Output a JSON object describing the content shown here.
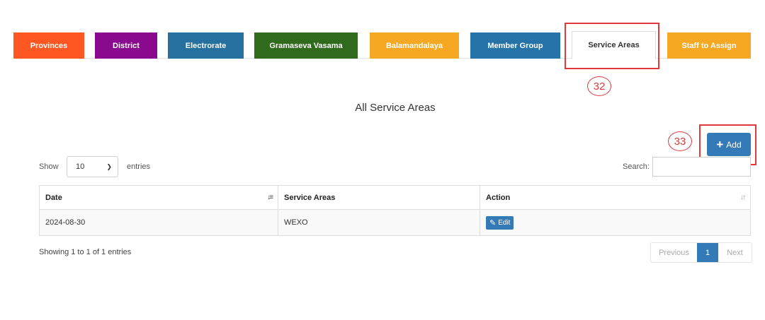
{
  "tabs": [
    {
      "label": "Provinces",
      "color": "#ff5722"
    },
    {
      "label": "District",
      "color": "#8a0a8f"
    },
    {
      "label": "Electrorate",
      "color": "#25709e"
    },
    {
      "label": "Gramaseva Vasama",
      "color": "#2f6a1d"
    },
    {
      "label": "Balamandalaya",
      "color": "#f7a823"
    },
    {
      "label": "Member Group",
      "color": "#2573a9"
    },
    {
      "label": "Service Areas",
      "active": true
    },
    {
      "label": "Staff to Assign",
      "color": "#f7a823"
    }
  ],
  "annotations": {
    "tab_marker": "32",
    "add_marker": "33",
    "color": "#e03a3a"
  },
  "page": {
    "title": "All Service Areas"
  },
  "toolbar": {
    "add_label": "Add"
  },
  "length": {
    "show_label": "Show",
    "value": "10",
    "entries_label": "entries"
  },
  "search": {
    "label": "Search:",
    "value": ""
  },
  "table": {
    "columns": [
      "Date",
      "Service Areas",
      "Action"
    ],
    "rows": [
      {
        "date": "2024-08-30",
        "service_area": "WEXO",
        "action": "Edit"
      }
    ]
  },
  "info": "Showing 1 to 1 of 1 entries",
  "pagination": {
    "previous": "Previous",
    "current": "1",
    "next": "Next"
  },
  "colors": {
    "primary": "#337ab7"
  }
}
